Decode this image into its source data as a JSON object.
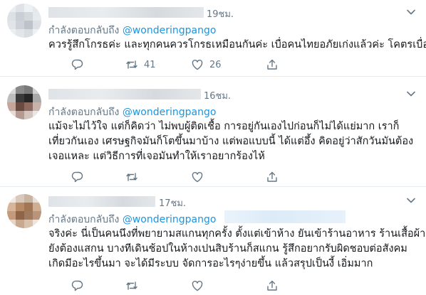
{
  "tweets": [
    {
      "time": "19ชม.",
      "reply_prefix": "กำลังตอบกลับถึง",
      "mention": "@wonderingpango",
      "lines": [
        "ควรรู้สึกโกรธค่ะ และทุกคนควรโกรธเหมือนกันค่ะ เบื่อคนไทยอภัยเก่งแล้วค่ะ โคตรเบื่อ"
      ],
      "retweets": "41",
      "likes": "26",
      "avatar_colors": [
        "#e9edf1",
        "#dfe3e8",
        "#eef1f4",
        "#e4e8ec",
        "#dce1e6",
        "#c9cfd6",
        "#d3d8dd",
        "#e6eaee",
        "#e1e5e9",
        "#cdd2d8",
        "#bcc3cb",
        "#dde1e5",
        "#eceff2",
        "#e2e6ea",
        "#d8dde2",
        "#eef0f3"
      ]
    },
    {
      "time": "16ชม.",
      "reply_prefix": "กำลังตอบกลับถึง",
      "mention": "@wonderingpango",
      "lines": [
        "แม้จะไม่ไว้ใจ แต่ก็คิดว่า ไม่พบผู้ติดเชื้อ การอยู่กันเองไปก่อนก็ไม่ได้แย่มาก เราก็",
        "เที่ยวกันเอง เศรษฐกิจมันก็โตขึ้นมาบ้าง แต่พอแบบนี้ ได้แต่อึ้ง คิดอยู่ว่าสักวันมันต้อง",
        "เจอแหละ แต่วิธีการที่เจอมันทำให้เราอยากร้องไห้"
      ],
      "retweets": "",
      "likes": "",
      "avatar_colors": [
        "#d9d9d9",
        "#8a8a8a",
        "#7a7a7a",
        "#d0d0d0",
        "#bdbdbd",
        "#3a3a3a",
        "#262626",
        "#a8a8a8",
        "#c4a79a",
        "#6b4a42",
        "#8d6a60",
        "#c7b3ab",
        "#e5dcd8",
        "#b49a90",
        "#d4c4be",
        "#ece6e3"
      ]
    },
    {
      "time": "17ชม.",
      "reply_prefix": "กำลังตอบกลับถึง",
      "mention": "@wonderingpango",
      "lines": [
        "จริงค่ะ นี่เป็นคนนึงที่พยายามสแกนทุกครั้ง ตั้งแต่เข้าห้าง ยันเข้าร้านอาหาร ร้านเสื้อผ้า",
        "ยังต้องแสกน บางทีเดินช้อปในห้างเปนสิบร้านก็สแกน รู้สึกอยากรับผิดชอบต่อสังคม",
        "เกิดมีอะไรขึ้นมา จะได้มีระบบ จัดการอะไรๆง่ายขึ้น แล้วสรุปเป็นงี้ เอิ่มมาก"
      ],
      "retweets": "",
      "likes": "",
      "avatar_colors": [
        "#efe9e3",
        "#d9c9bc",
        "#c9b3a1",
        "#e8e0d8",
        "#d6b59a",
        "#b98a66",
        "#a27555",
        "#cfae93",
        "#c39a7b",
        "#8f6448",
        "#a07a5f",
        "#b8957a",
        "#e4d6ca",
        "#c6a98f",
        "#d8c1ad",
        "#ede4dc"
      ]
    }
  ]
}
